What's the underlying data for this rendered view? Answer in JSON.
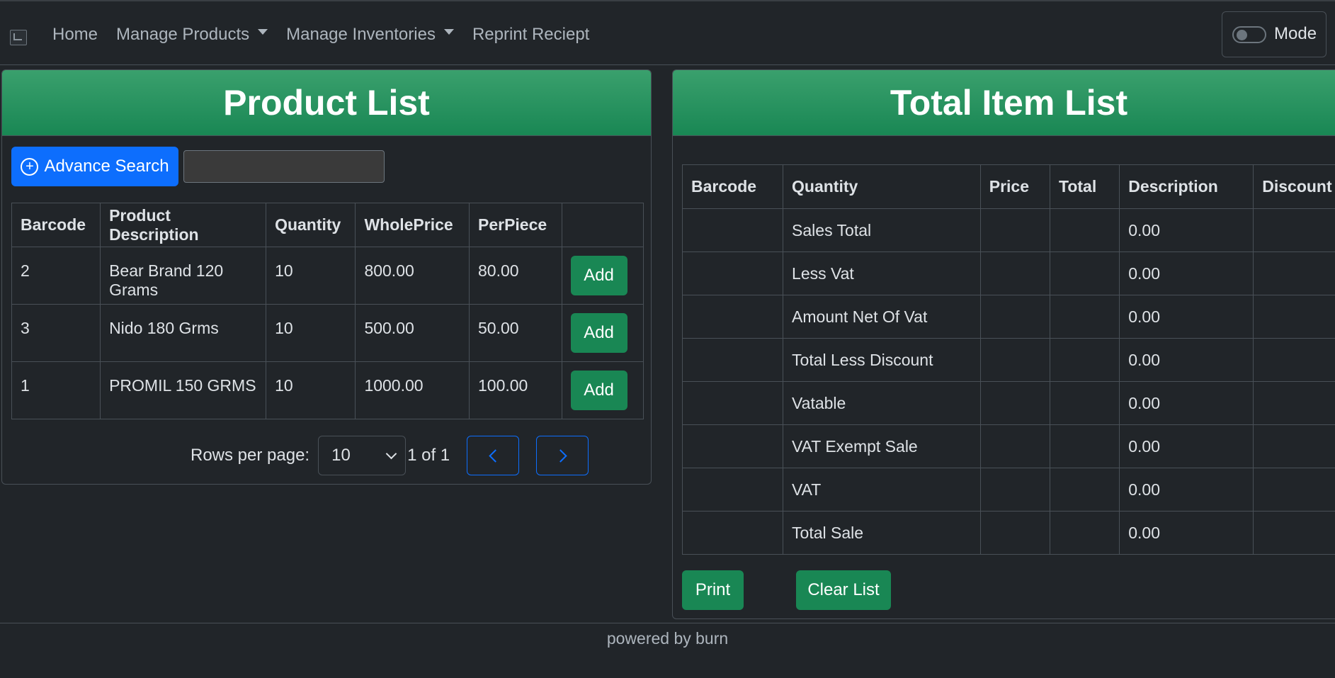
{
  "navbar": {
    "items": [
      {
        "label": "Home",
        "dropdown": false
      },
      {
        "label": "Manage Products",
        "dropdown": true
      },
      {
        "label": "Manage Inventories",
        "dropdown": true
      },
      {
        "label": "Reprint Reciept",
        "dropdown": false
      }
    ],
    "mode_label": "Mode",
    "mode_on": false
  },
  "product_list": {
    "title": "Product List",
    "advance_search_label": "Advance Search",
    "search_value": "",
    "columns": [
      "Barcode",
      "Product Description",
      "Quantity",
      "WholePrice",
      "PerPiece",
      ""
    ],
    "rows": [
      {
        "barcode": "2",
        "description": "Bear Brand 120 Grams",
        "quantity": "10",
        "whole_price": "800.00",
        "per_piece": "80.00",
        "action": "Add"
      },
      {
        "barcode": "3",
        "description": "Nido 180 Grms",
        "quantity": "10",
        "whole_price": "500.00",
        "per_piece": "50.00",
        "action": "Add"
      },
      {
        "barcode": "1",
        "description": "PROMIL 150 GRMS",
        "quantity": "10",
        "whole_price": "1000.00",
        "per_piece": "100.00",
        "action": "Add"
      }
    ],
    "pagination": {
      "rows_per_page_label": "Rows per page:",
      "rows_per_page": "10",
      "page_info": "1 of 1"
    }
  },
  "total_item_list": {
    "title": "Total Item List",
    "columns": [
      "Barcode",
      "Quantity",
      "Price",
      "Total",
      "Description",
      "Discount"
    ],
    "rows": [
      {
        "barcode": "",
        "quantity": "Sales Total",
        "price": "",
        "total": "",
        "description": "0.00",
        "discount": ""
      },
      {
        "barcode": "",
        "quantity": "Less Vat",
        "price": "",
        "total": "",
        "description": "0.00",
        "discount": ""
      },
      {
        "barcode": "",
        "quantity": "Amount Net Of Vat",
        "price": "",
        "total": "",
        "description": "0.00",
        "discount": ""
      },
      {
        "barcode": "",
        "quantity": "Total Less Discount",
        "price": "",
        "total": "",
        "description": "0.00",
        "discount": ""
      },
      {
        "barcode": "",
        "quantity": "Vatable",
        "price": "",
        "total": "",
        "description": "0.00",
        "discount": ""
      },
      {
        "barcode": "",
        "quantity": "VAT Exempt Sale",
        "price": "",
        "total": "",
        "description": "0.00",
        "discount": ""
      },
      {
        "barcode": "",
        "quantity": "VAT",
        "price": "",
        "total": "",
        "description": "0.00",
        "discount": ""
      },
      {
        "barcode": "",
        "quantity": "Total Sale",
        "price": "",
        "total": "",
        "description": "0.00",
        "discount": ""
      }
    ],
    "print_label": "Print",
    "clear_label": "Clear List"
  },
  "footer": {
    "text": "powered by burn"
  },
  "colors": {
    "background": "#212529",
    "header_green": "#198754",
    "primary_blue": "#0d6efd"
  }
}
